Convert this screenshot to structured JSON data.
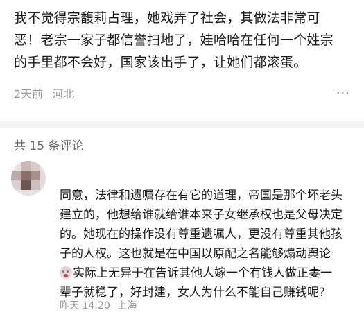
{
  "post": {
    "lines": [
      "我不觉得宗馥莉占理，她戏弄了社会，其做法非常可",
      "恶！老宗一家子都信誉扫地了，娃哈哈在任何一个姓宗",
      "的手里都不会好，国家该出手了，让她们都滚蛋。"
    ],
    "time": "2天前",
    "location": "河北",
    "more_label": "···"
  },
  "comments": {
    "header": "共 15 条评论"
  },
  "reply": {
    "lines": [
      "同意，法律和遗嘱存在有它的道理，帝国是那个坏老头",
      "建立的，他想给谁就给谁本来子女继承权也是父母决定",
      "的。她现在的操作没有尊重遗嘱人，更没有尊重其他孩",
      "子的人权。这也就是在中国以原配之名能够煽动舆论",
      "实际上无异于在告诉其他人嫁一个有钱人做正妻一",
      "辈子就稳了，好封建，女人为什么不能自己赚钱呢?"
    ],
    "emoji_icon": "crying-face-icon",
    "time": "昨天 14:20",
    "location": "上海"
  }
}
